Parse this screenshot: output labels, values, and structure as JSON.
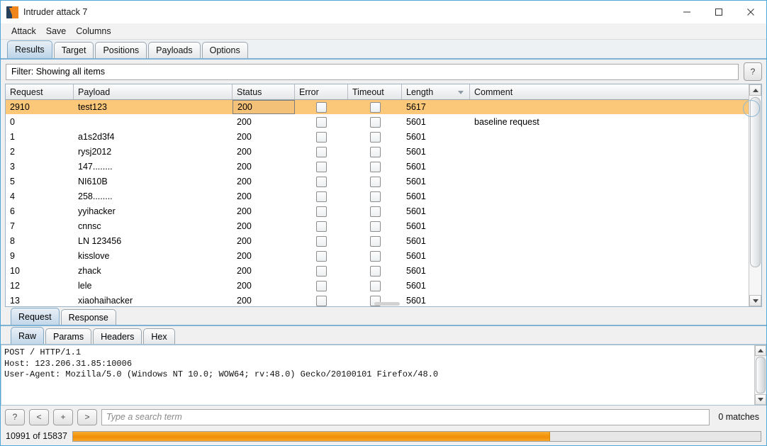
{
  "window": {
    "title": "Intruder attack 7",
    "icon": "burp-suite-icon",
    "minimize_label": "Minimize",
    "maximize_label": "Maximize",
    "close_label": "Close"
  },
  "menubar": {
    "items": [
      {
        "label": "Attack"
      },
      {
        "label": "Save"
      },
      {
        "label": "Columns"
      }
    ]
  },
  "tabs": {
    "items": [
      {
        "label": "Results",
        "active": true
      },
      {
        "label": "Target",
        "active": false
      },
      {
        "label": "Positions",
        "active": false
      },
      {
        "label": "Payloads",
        "active": false
      },
      {
        "label": "Options",
        "active": false
      }
    ]
  },
  "filter": {
    "text": "Filter: Showing all items",
    "help_label": "?"
  },
  "results_table": {
    "columns": [
      {
        "label": "Request"
      },
      {
        "label": "Payload"
      },
      {
        "label": "Status"
      },
      {
        "label": "Error"
      },
      {
        "label": "Timeout"
      },
      {
        "label": "Length",
        "sorted": "desc"
      },
      {
        "label": "Comment"
      }
    ],
    "rows": [
      {
        "request": "2910",
        "payload": "test123",
        "status": "200",
        "error": false,
        "timeout": false,
        "length": "5617",
        "comment": "",
        "selected": true
      },
      {
        "request": "0",
        "payload": "",
        "status": "200",
        "error": false,
        "timeout": false,
        "length": "5601",
        "comment": "baseline request",
        "selected": false
      },
      {
        "request": "1",
        "payload": "a1s2d3f4",
        "status": "200",
        "error": false,
        "timeout": false,
        "length": "5601",
        "comment": "",
        "selected": false
      },
      {
        "request": "2",
        "payload": "rysj2012",
        "status": "200",
        "error": false,
        "timeout": false,
        "length": "5601",
        "comment": "",
        "selected": false
      },
      {
        "request": "3",
        "payload": "147........",
        "status": "200",
        "error": false,
        "timeout": false,
        "length": "5601",
        "comment": "",
        "selected": false
      },
      {
        "request": "5",
        "payload": "NI610B",
        "status": "200",
        "error": false,
        "timeout": false,
        "length": "5601",
        "comment": "",
        "selected": false
      },
      {
        "request": "4",
        "payload": "258........",
        "status": "200",
        "error": false,
        "timeout": false,
        "length": "5601",
        "comment": "",
        "selected": false
      },
      {
        "request": "6",
        "payload": "yyihacker",
        "status": "200",
        "error": false,
        "timeout": false,
        "length": "5601",
        "comment": "",
        "selected": false
      },
      {
        "request": "7",
        "payload": "cnnsc",
        "status": "200",
        "error": false,
        "timeout": false,
        "length": "5601",
        "comment": "",
        "selected": false
      },
      {
        "request": "8",
        "payload": "LN 123456",
        "status": "200",
        "error": false,
        "timeout": false,
        "length": "5601",
        "comment": "",
        "selected": false
      },
      {
        "request": "9",
        "payload": "kisslove",
        "status": "200",
        "error": false,
        "timeout": false,
        "length": "5601",
        "comment": "",
        "selected": false
      },
      {
        "request": "10",
        "payload": "zhack",
        "status": "200",
        "error": false,
        "timeout": false,
        "length": "5601",
        "comment": "",
        "selected": false
      },
      {
        "request": "12",
        "payload": "lele",
        "status": "200",
        "error": false,
        "timeout": false,
        "length": "5601",
        "comment": "",
        "selected": false
      },
      {
        "request": "13",
        "payload": "xiaohaihacker",
        "status": "200",
        "error": false,
        "timeout": false,
        "length": "5601",
        "comment": "",
        "selected": false
      }
    ]
  },
  "message_tabs": {
    "items": [
      {
        "label": "Request",
        "active": true
      },
      {
        "label": "Response",
        "active": false
      }
    ]
  },
  "view_tabs": {
    "items": [
      {
        "label": "Raw",
        "active": true
      },
      {
        "label": "Params",
        "active": false
      },
      {
        "label": "Headers",
        "active": false
      },
      {
        "label": "Hex",
        "active": false
      }
    ]
  },
  "raw_request": {
    "text": "POST / HTTP/1.1\nHost: 123.206.31.85:10006\nUser-Agent: Mozilla/5.0 (Windows NT 10.0; WOW64; rv:48.0) Gecko/20100101 Firefox/48.0"
  },
  "search": {
    "help_label": "?",
    "prev_label": "<",
    "add_label": "+",
    "next_label": ">",
    "placeholder": "Type a search term",
    "value": "",
    "matches": "0 matches"
  },
  "progress": {
    "label": "10991 of 15837",
    "current": 10991,
    "total": 15837,
    "percent": 69.4,
    "fill_color": "#f59a0e"
  },
  "colors": {
    "selection_orange": "#fbc87a",
    "tab_active_blue": "#bcd4e8",
    "window_border": "#4fa8d8"
  }
}
